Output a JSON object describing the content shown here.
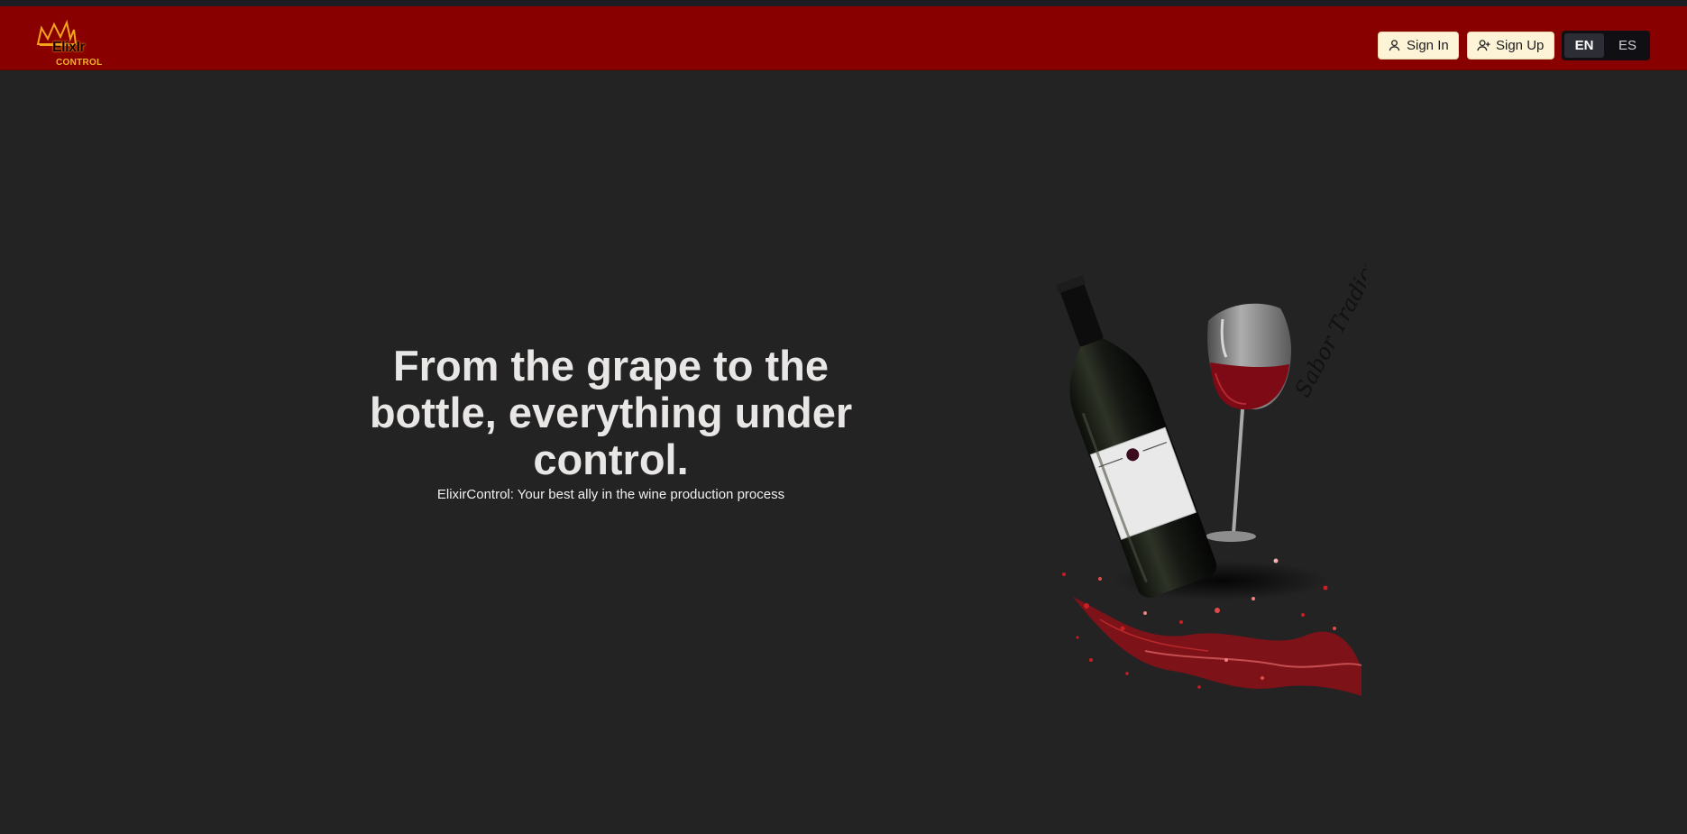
{
  "logo": {
    "wordmark": "ElixIr",
    "sub": "CONTROL"
  },
  "header": {
    "signin_label": "Sign In",
    "signup_label": "Sign Up",
    "languages": [
      "EN",
      "ES"
    ],
    "active_language": "EN"
  },
  "hero": {
    "title": "From the grape to the bottle, everything under control.",
    "subtitle": "ElixirControl: Your best ally in the wine production process"
  },
  "illustration": {
    "signature": "Sabor Tradicional"
  },
  "colors": {
    "navbar": "#890000",
    "background": "#232323",
    "button": "#fdf4d8",
    "wine": "#b0101a"
  },
  "icons": [
    "user-icon",
    "user-plus-icon"
  ]
}
